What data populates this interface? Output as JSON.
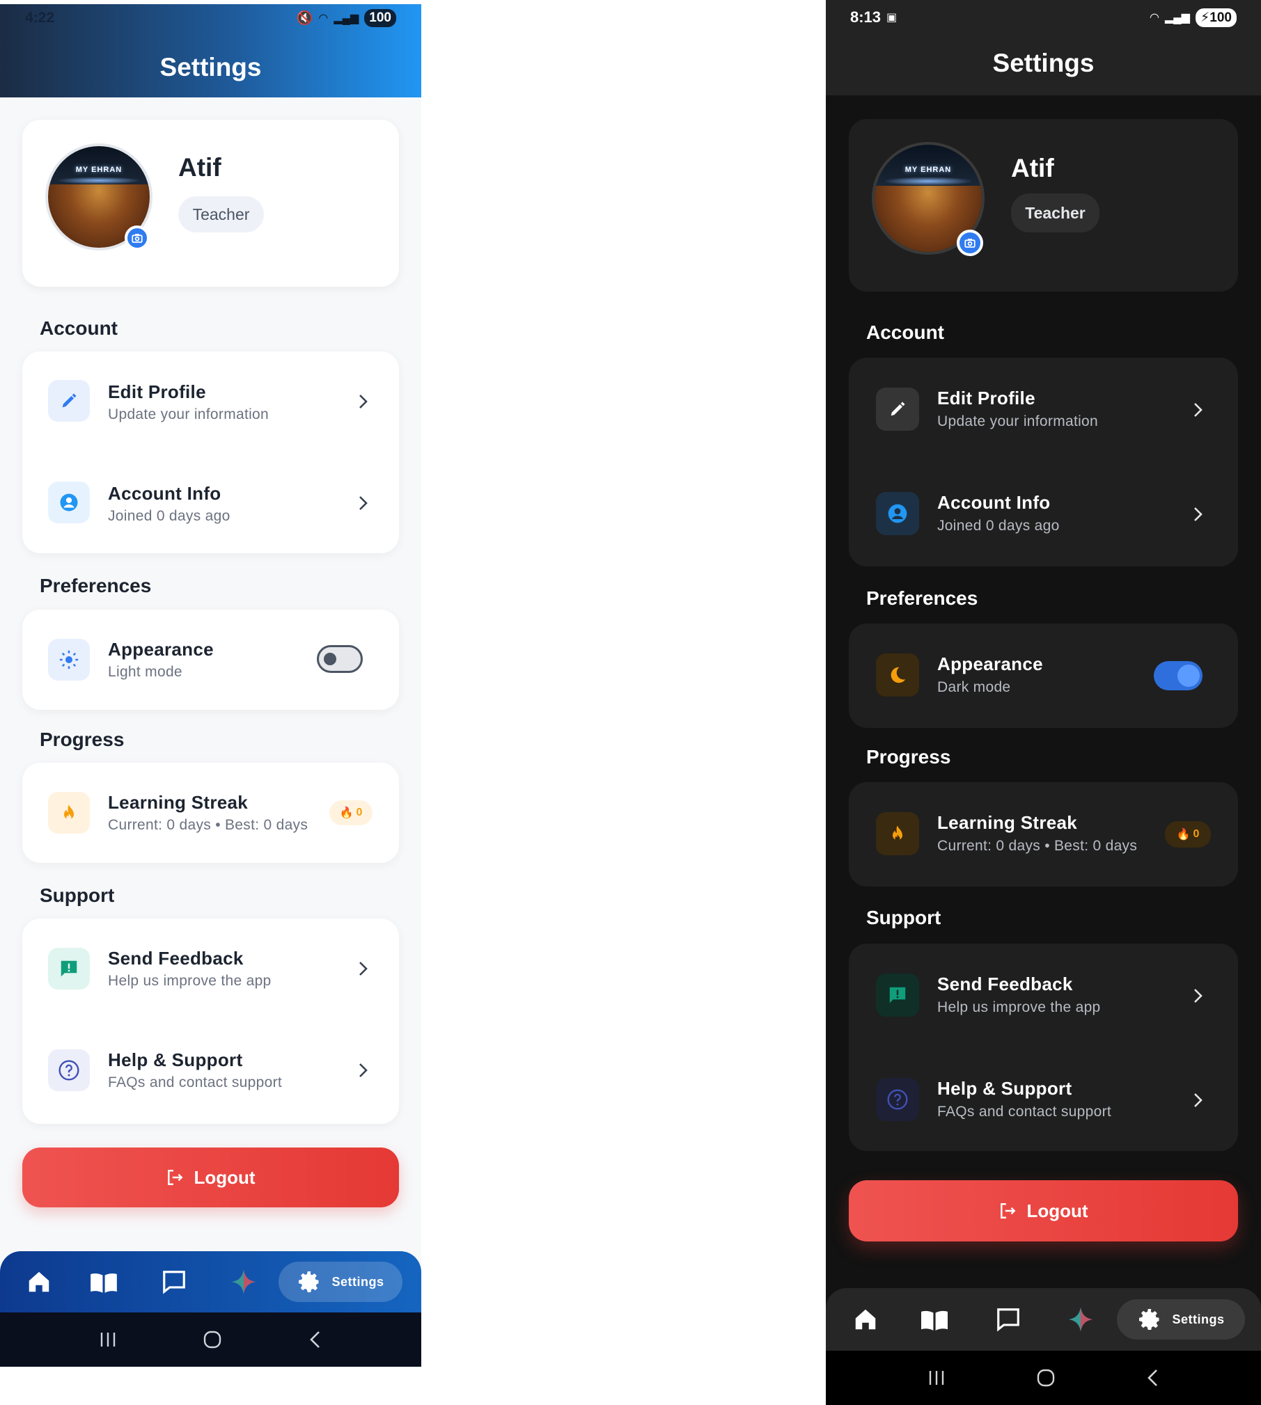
{
  "light": {
    "status": {
      "time": "4:22",
      "battery": "100"
    },
    "header": {
      "title": "Settings"
    },
    "profile": {
      "name": "Atif",
      "role": "Teacher",
      "avatar_sign": "MY EHRAN"
    },
    "sections": {
      "account": "Account",
      "preferences": "Preferences",
      "progress": "Progress",
      "support": "Support"
    },
    "account": {
      "edit_title": "Edit Profile",
      "edit_sub": "Update your information",
      "info_title": "Account Info",
      "info_sub": "Joined 0 days ago"
    },
    "preferences": {
      "appearance_title": "Appearance",
      "appearance_sub": "Light mode",
      "dark_mode_on": false
    },
    "progress": {
      "streak_title": "Learning Streak",
      "streak_sub": "Current: 0 days • Best: 0 days",
      "streak_count": "0"
    },
    "support": {
      "feedback_title": "Send Feedback",
      "feedback_sub": "Help us improve the app",
      "help_title": "Help & Support",
      "help_sub": "FAQs and contact support"
    },
    "logout_label": "Logout",
    "nav": {
      "active_label": "Settings",
      "items": [
        "home-icon",
        "book-icon",
        "chat-icon",
        "sparkle-icon",
        "gear-icon"
      ]
    }
  },
  "dark": {
    "status": {
      "time": "8:13",
      "battery": "100"
    },
    "header": {
      "title": "Settings"
    },
    "profile": {
      "name": "Atif",
      "role": "Teacher",
      "avatar_sign": "MY EHRAN"
    },
    "sections": {
      "account": "Account",
      "preferences": "Preferences",
      "progress": "Progress",
      "support": "Support"
    },
    "account": {
      "edit_title": "Edit Profile",
      "edit_sub": "Update your information",
      "info_title": "Account Info",
      "info_sub": "Joined 0 days ago"
    },
    "preferences": {
      "appearance_title": "Appearance",
      "appearance_sub": "Dark mode",
      "dark_mode_on": true
    },
    "progress": {
      "streak_title": "Learning Streak",
      "streak_sub": "Current: 0 days • Best: 0 days",
      "streak_count": "0"
    },
    "support": {
      "feedback_title": "Send Feedback",
      "feedback_sub": "Help us improve the app",
      "help_title": "Help & Support",
      "help_sub": "FAQs and contact support"
    },
    "logout_label": "Logout",
    "nav": {
      "active_label": "Settings",
      "items": [
        "home-icon",
        "book-icon",
        "chat-icon",
        "sparkle-icon",
        "gear-icon"
      ]
    }
  },
  "colors": {
    "accent_blue": "#2f7bf0",
    "logout_red": "#e53935",
    "streak_orange": "#f59e0b",
    "feedback_teal": "#0f9d7a",
    "help_indigo": "#3f51b5"
  }
}
